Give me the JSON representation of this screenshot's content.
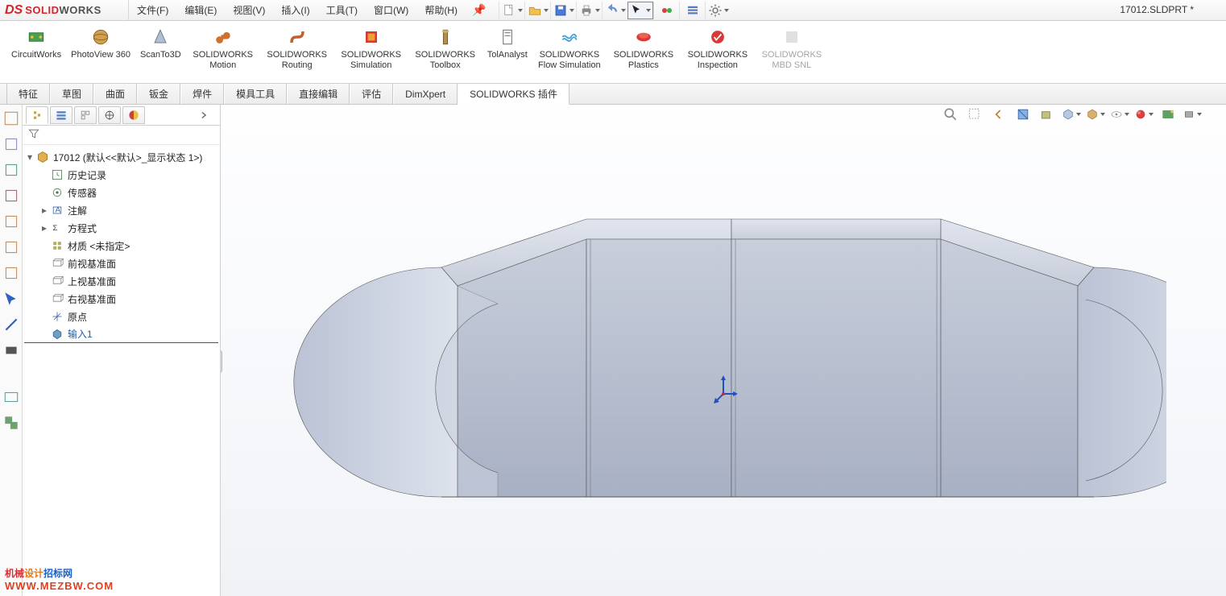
{
  "app": {
    "brand_solid": "SOLID",
    "brand_works": "WORKS",
    "doc_title": "17012.SLDPRT *"
  },
  "menu": {
    "file": "文件(F)",
    "edit": "编辑(E)",
    "view": "视图(V)",
    "insert": "插入(I)",
    "tools": "工具(T)",
    "window": "窗口(W)",
    "help": "帮助(H)"
  },
  "ribbon": {
    "items": [
      "CircuitWorks",
      "PhotoView 360",
      "ScanTo3D",
      "SOLIDWORKS Motion",
      "SOLIDWORKS Routing",
      "SOLIDWORKS Simulation",
      "SOLIDWORKS Toolbox",
      "TolAnalyst",
      "SOLIDWORKS Flow Simulation",
      "SOLIDWORKS Plastics",
      "SOLIDWORKS Inspection",
      "SOLIDWORKS MBD SNL"
    ]
  },
  "tabs": {
    "items": [
      "特征",
      "草图",
      "曲面",
      "钣金",
      "焊件",
      "模具工具",
      "直接编辑",
      "评估",
      "DimXpert",
      "SOLIDWORKS 插件"
    ],
    "active": 9
  },
  "tree": {
    "root": "17012  (默认<<默认>_显示状态 1>)",
    "nodes": [
      {
        "label": "历史记录",
        "icon": "history"
      },
      {
        "label": "传感器",
        "icon": "sensor"
      },
      {
        "label": "注解",
        "icon": "annotation",
        "expandable": true
      },
      {
        "label": "方程式",
        "icon": "equation",
        "expandable": true
      },
      {
        "label": "材质 <未指定>",
        "icon": "material"
      },
      {
        "label": "前视基准面",
        "icon": "plane"
      },
      {
        "label": "上视基准面",
        "icon": "plane"
      },
      {
        "label": "右视基准面",
        "icon": "plane"
      },
      {
        "label": "原点",
        "icon": "origin"
      },
      {
        "label": "输入1",
        "icon": "import",
        "selected": true
      }
    ]
  },
  "watermark": {
    "line1": "机械设计招标网",
    "line2": "WWW.MEZBW.COM"
  }
}
